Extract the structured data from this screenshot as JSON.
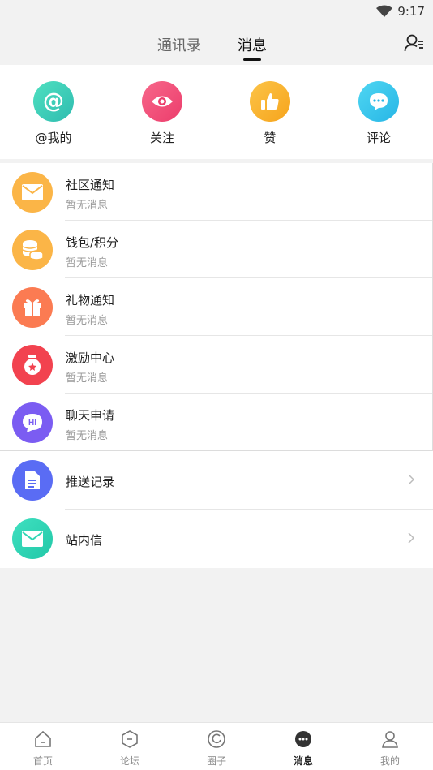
{
  "status": {
    "time": "9:17"
  },
  "header": {
    "tabs": [
      "通讯录",
      "消息"
    ],
    "active_tab": "消息"
  },
  "quick_actions": [
    {
      "label": "@我的",
      "icon": "at-icon",
      "color": "#3fd0b8"
    },
    {
      "label": "关注",
      "icon": "eye-icon",
      "color": "#f2507a"
    },
    {
      "label": "赞",
      "icon": "thumbs-up-icon",
      "color": "#f7b52c"
    },
    {
      "label": "评论",
      "icon": "chat-bubble-icon",
      "color": "#3bc8ec"
    }
  ],
  "messages": [
    {
      "title": "社区通知",
      "subtitle": "暂无消息",
      "icon": "envelope-icon",
      "color": "#fbb547"
    },
    {
      "title": "钱包/积分",
      "subtitle": "暂无消息",
      "icon": "coins-icon",
      "color": "#fbb547"
    },
    {
      "title": "礼物通知",
      "subtitle": "暂无消息",
      "icon": "gift-icon",
      "color": "#fb7b52"
    },
    {
      "title": "激励中心",
      "subtitle": "暂无消息",
      "icon": "medal-icon",
      "color": "#f2424f"
    },
    {
      "title": "聊天申请",
      "subtitle": "暂无消息",
      "icon": "hi-chat-icon",
      "color": "#7b5cf2"
    }
  ],
  "nav_items": [
    {
      "title": "推送记录",
      "icon": "document-icon",
      "color": "#5a6cf4"
    },
    {
      "title": "站内信",
      "icon": "envelope-icon",
      "color": "#2fd6b4"
    }
  ],
  "bottom_nav": [
    {
      "label": "首页",
      "icon": "home-icon"
    },
    {
      "label": "论坛",
      "icon": "forum-icon"
    },
    {
      "label": "圈子",
      "icon": "circle-icon"
    },
    {
      "label": "消息",
      "icon": "message-icon",
      "active": true
    },
    {
      "label": "我的",
      "icon": "profile-icon"
    }
  ]
}
